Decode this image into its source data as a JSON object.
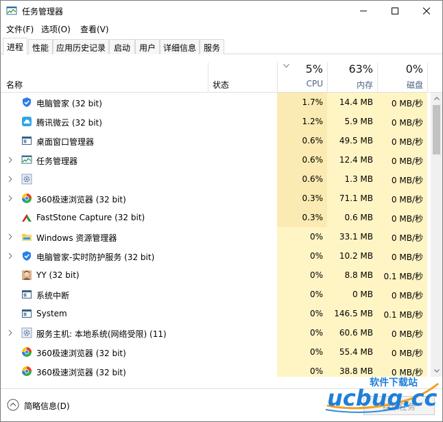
{
  "window": {
    "title": "任务管理器"
  },
  "menu": [
    {
      "label": "文件(F)"
    },
    {
      "label": "选项(O)"
    },
    {
      "label": "查看(V)"
    }
  ],
  "tabs": [
    {
      "label": "进程",
      "active": true
    },
    {
      "label": "性能"
    },
    {
      "label": "应用历史记录"
    },
    {
      "label": "启动"
    },
    {
      "label": "用户"
    },
    {
      "label": "详细信息"
    },
    {
      "label": "服务"
    }
  ],
  "columns": {
    "name": "名称",
    "status": "状态",
    "cpu": {
      "percent": "5%",
      "label": "CPU"
    },
    "memory": {
      "percent": "63%",
      "label": "内存"
    },
    "disk": {
      "percent": "0%",
      "label": "磁盘"
    }
  },
  "processes": [
    {
      "name": "电脑管家 (32 bit)",
      "icon": "shield-icon",
      "expandable": false,
      "cpu": "1.7%",
      "memory": "14.4 MB",
      "disk": "0 MB/秒"
    },
    {
      "name": "腾讯微云 (32 bit)",
      "icon": "cloud-icon",
      "expandable": false,
      "cpu": "1.2%",
      "memory": "5.9 MB",
      "disk": "0 MB/秒"
    },
    {
      "name": "桌面窗口管理器",
      "icon": "window-icon",
      "expandable": false,
      "cpu": "0.6%",
      "memory": "49.5 MB",
      "disk": "0 MB/秒"
    },
    {
      "name": "任务管理器",
      "icon": "task-manager-icon",
      "expandable": true,
      "cpu": "0.6%",
      "memory": "12.4 MB",
      "disk": "0 MB/秒"
    },
    {
      "name": "",
      "icon": "gear-icon",
      "expandable": true,
      "cpu": "0.6%",
      "memory": "1.3 MB",
      "disk": "0 MB/秒"
    },
    {
      "name": "360极速浏览器 (32 bit)",
      "icon": "browser-icon",
      "expandable": true,
      "cpu": "0.3%",
      "memory": "71.1 MB",
      "disk": "0 MB/秒"
    },
    {
      "name": "FastStone Capture (32 bit)",
      "icon": "capture-icon",
      "expandable": false,
      "cpu": "0.3%",
      "memory": "0.6 MB",
      "disk": "0 MB/秒"
    },
    {
      "name": "Windows 资源管理器",
      "icon": "folder-icon",
      "expandable": true,
      "cpu": "0%",
      "memory": "33.1 MB",
      "disk": "0 MB/秒"
    },
    {
      "name": "电脑管家-实时防护服务 (32 bit)",
      "icon": "shield-icon",
      "expandable": true,
      "cpu": "0%",
      "memory": "10.2 MB",
      "disk": "0 MB/秒"
    },
    {
      "name": "YY (32 bit)",
      "icon": "yy-avatar-icon",
      "expandable": false,
      "cpu": "0%",
      "memory": "8.8 MB",
      "disk": "0.1 MB/秒"
    },
    {
      "name": "系统中断",
      "icon": "window-icon",
      "expandable": false,
      "cpu": "0%",
      "memory": "0 MB",
      "disk": "0 MB/秒"
    },
    {
      "name": "System",
      "icon": "window-icon",
      "expandable": false,
      "cpu": "0%",
      "memory": "146.5 MB",
      "disk": "0.1 MB/秒"
    },
    {
      "name": "服务主机: 本地系统(网络受限) (11)",
      "icon": "gear-icon",
      "expandable": true,
      "cpu": "0%",
      "memory": "60.6 MB",
      "disk": "0 MB/秒"
    },
    {
      "name": "360极速浏览器 (32 bit)",
      "icon": "browser-icon",
      "expandable": false,
      "cpu": "0%",
      "memory": "55.4 MB",
      "disk": "0 MB/秒"
    },
    {
      "name": "360极速浏览器 (32 bit)",
      "icon": "browser-icon",
      "expandable": false,
      "cpu": "0%",
      "memory": "38.8 MB",
      "disk": "0 MB/秒"
    }
  ],
  "footer": {
    "fewer_details": "简略信息(D)",
    "end_task": "结束任务"
  },
  "watermark": {
    "line1": "软件下载站",
    "line2": "ucbug.cc"
  }
}
